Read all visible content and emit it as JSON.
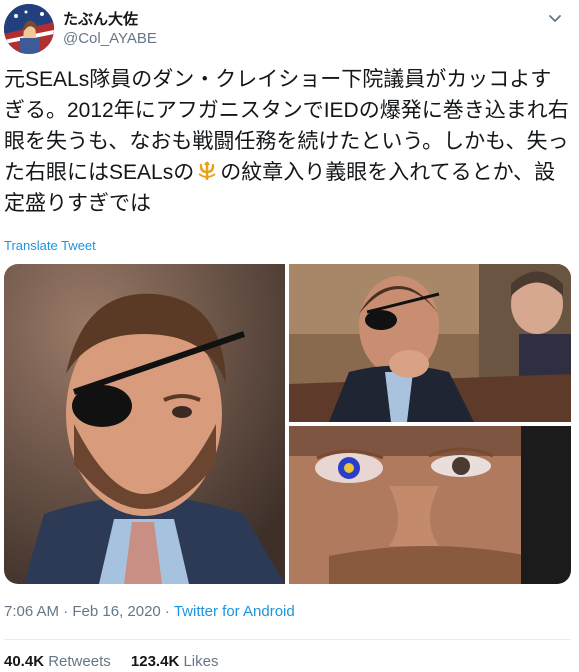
{
  "user": {
    "display_name": "たぶん大佐",
    "handle": "@Col_AYABE"
  },
  "tweet": {
    "text": "元SEALs隊員のダン・クレイショー下院議員がカッコよすぎる。2012年にアフガニスタンでIEDの爆発に巻き込まれ右眼を失うも、なおも戦闘任務を続けたという。しかも、失った右眼にはSEALsの",
    "text_after_icon": "の紋章入り義眼を入れてるとか、設定盛りすぎでは",
    "translate_label": "Translate Tweet"
  },
  "meta": {
    "time_date": "7:06 AM · Feb 16, 2020 · ",
    "source": "Twitter for Android"
  },
  "stats": {
    "retweets_count": "40.4K",
    "retweets_label": "Retweets",
    "likes_count": "123.4K",
    "likes_label": "Likes"
  },
  "icons": {
    "caret": "chevron-down-icon",
    "inline_emblem": "trident-emblem-icon"
  }
}
